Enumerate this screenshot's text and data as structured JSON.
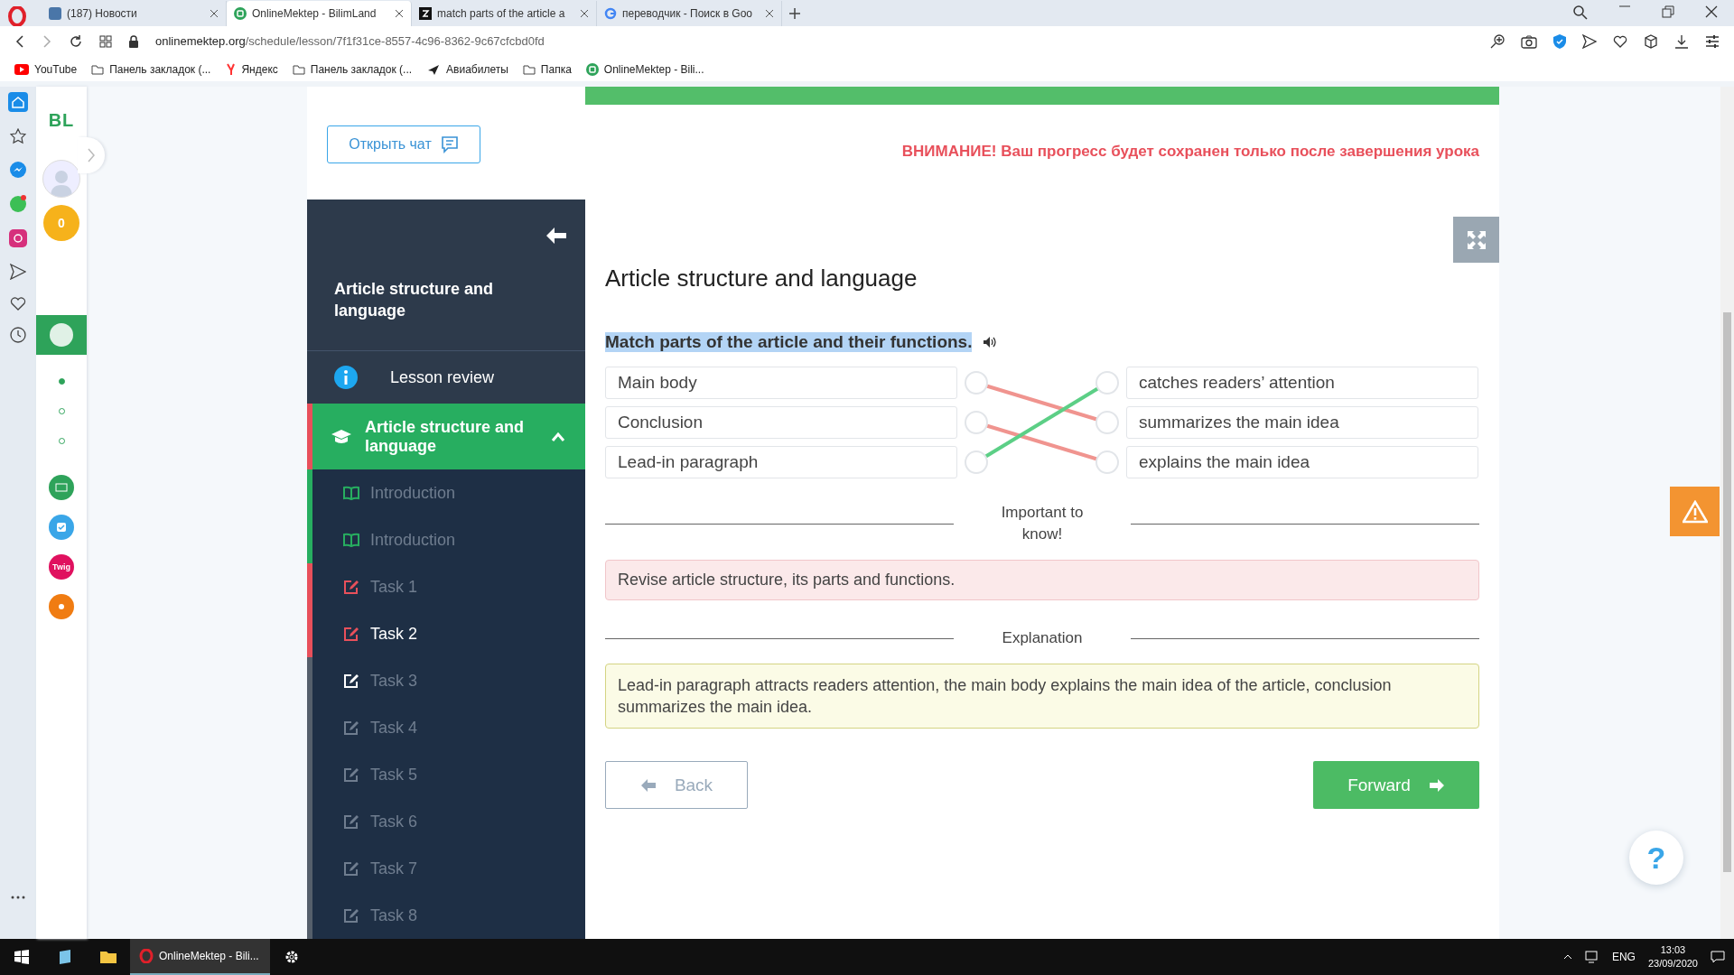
{
  "browser": {
    "tabs": [
      {
        "title": "(187) Новости",
        "kind": "vk",
        "selected": false
      },
      {
        "title": "OnlineMektep - BilimLand",
        "kind": "site",
        "selected": true
      },
      {
        "title": "match parts of the article a",
        "kind": "z",
        "selected": false
      },
      {
        "title": "переводчик - Поиск в Goo",
        "kind": "google",
        "selected": false
      }
    ],
    "address": {
      "host": "onlinemektep.org",
      "path": "/schedule/lesson/7f1f31ce-8557-4c96-8362-9c67cfcbd0fd"
    },
    "bookmarks": [
      {
        "label": "YouTube",
        "kind": "youtube"
      },
      {
        "label": "Панель закладок (...",
        "kind": "folder"
      },
      {
        "label": "Яндекс",
        "kind": "yandex"
      },
      {
        "label": "Панель закладок (...",
        "kind": "folder"
      },
      {
        "label": "Авиабилеты",
        "kind": "plane"
      },
      {
        "label": "Папка",
        "kind": "folder"
      },
      {
        "label": "OnlineMektep - Bili...",
        "kind": "site"
      }
    ]
  },
  "app_sidebar": {
    "logo": "BL",
    "coins": "0",
    "steps": [
      {
        "selected": true
      },
      {
        "selected": false
      },
      {
        "selected": false
      }
    ],
    "apps": [
      {
        "kind": "bilimland",
        "color": "#2ea35a"
      },
      {
        "kind": "itest",
        "color": "#3aa6e8"
      },
      {
        "kind": "twig",
        "label": "Twig",
        "color": "#e0115f"
      },
      {
        "kind": "imektep",
        "color": "#f07c12"
      }
    ]
  },
  "chat_button": "Открыть чат",
  "warning": "ВНИМАНИЕ! Ваш прогресс будет сохранен только после завершения урока",
  "lesson_nav": {
    "title": "Article structure and language",
    "review": "Lesson review",
    "section": {
      "title": "Article structure and language",
      "expanded": true
    },
    "items": [
      {
        "label": "Introduction",
        "kind": "reading",
        "color": "#27ae60",
        "active": false,
        "selected": false
      },
      {
        "label": "Introduction",
        "kind": "reading",
        "color": "#27ae60",
        "active": false,
        "selected": false
      },
      {
        "label": "Task 1",
        "kind": "task",
        "color": "#e8505b",
        "active": false,
        "selected": false
      },
      {
        "label": "Task 2",
        "kind": "task",
        "color": "#e8505b",
        "active": false,
        "selected": true
      },
      {
        "label": "Task 3",
        "kind": "task",
        "color": "#555f6b",
        "active": true,
        "selected": false
      },
      {
        "label": "Task 4",
        "kind": "task",
        "color": "#555f6b",
        "active": false,
        "selected": false
      },
      {
        "label": "Task 5",
        "kind": "task",
        "color": "#555f6b",
        "active": false,
        "selected": false
      },
      {
        "label": "Task 6",
        "kind": "task",
        "color": "#555f6b",
        "active": false,
        "selected": false
      },
      {
        "label": "Task 7",
        "kind": "task",
        "color": "#555f6b",
        "active": false,
        "selected": false
      },
      {
        "label": "Task 8",
        "kind": "task",
        "color": "#555f6b",
        "active": false,
        "selected": false
      }
    ]
  },
  "task": {
    "title": "Article structure and language",
    "instruction": {
      "text": "Match parts of the article and their functions.",
      "highlighted": true
    },
    "left": [
      {
        "text": "Main body",
        "links": [
          false,
          true,
          false
        ],
        "correct": false
      },
      {
        "text": "Conclusion",
        "links": [
          false,
          false,
          true
        ],
        "correct": false
      },
      {
        "text": "Lead-in paragraph",
        "links": [
          true,
          false,
          false
        ],
        "correct": true
      }
    ],
    "right": [
      {
        "text": "catches readers’ attention"
      },
      {
        "text": "summarizes the main idea"
      },
      {
        "text": "explains the main idea"
      }
    ]
  },
  "important": {
    "heading": "Important to know!",
    "text": "Revise article structure, its parts and functions."
  },
  "explanation": {
    "heading": "Explanation",
    "text": "Lead-in paragraph attracts readers attention, the main body explains the main idea of the article, conclusion summarizes the main idea."
  },
  "help_button": "?",
  "back_button": "Back",
  "forward_button": "Forward",
  "taskbar": {
    "app": "OnlineMektep - Bili...",
    "lang": "ENG",
    "time": "13:03",
    "date": "23/09/2020"
  }
}
